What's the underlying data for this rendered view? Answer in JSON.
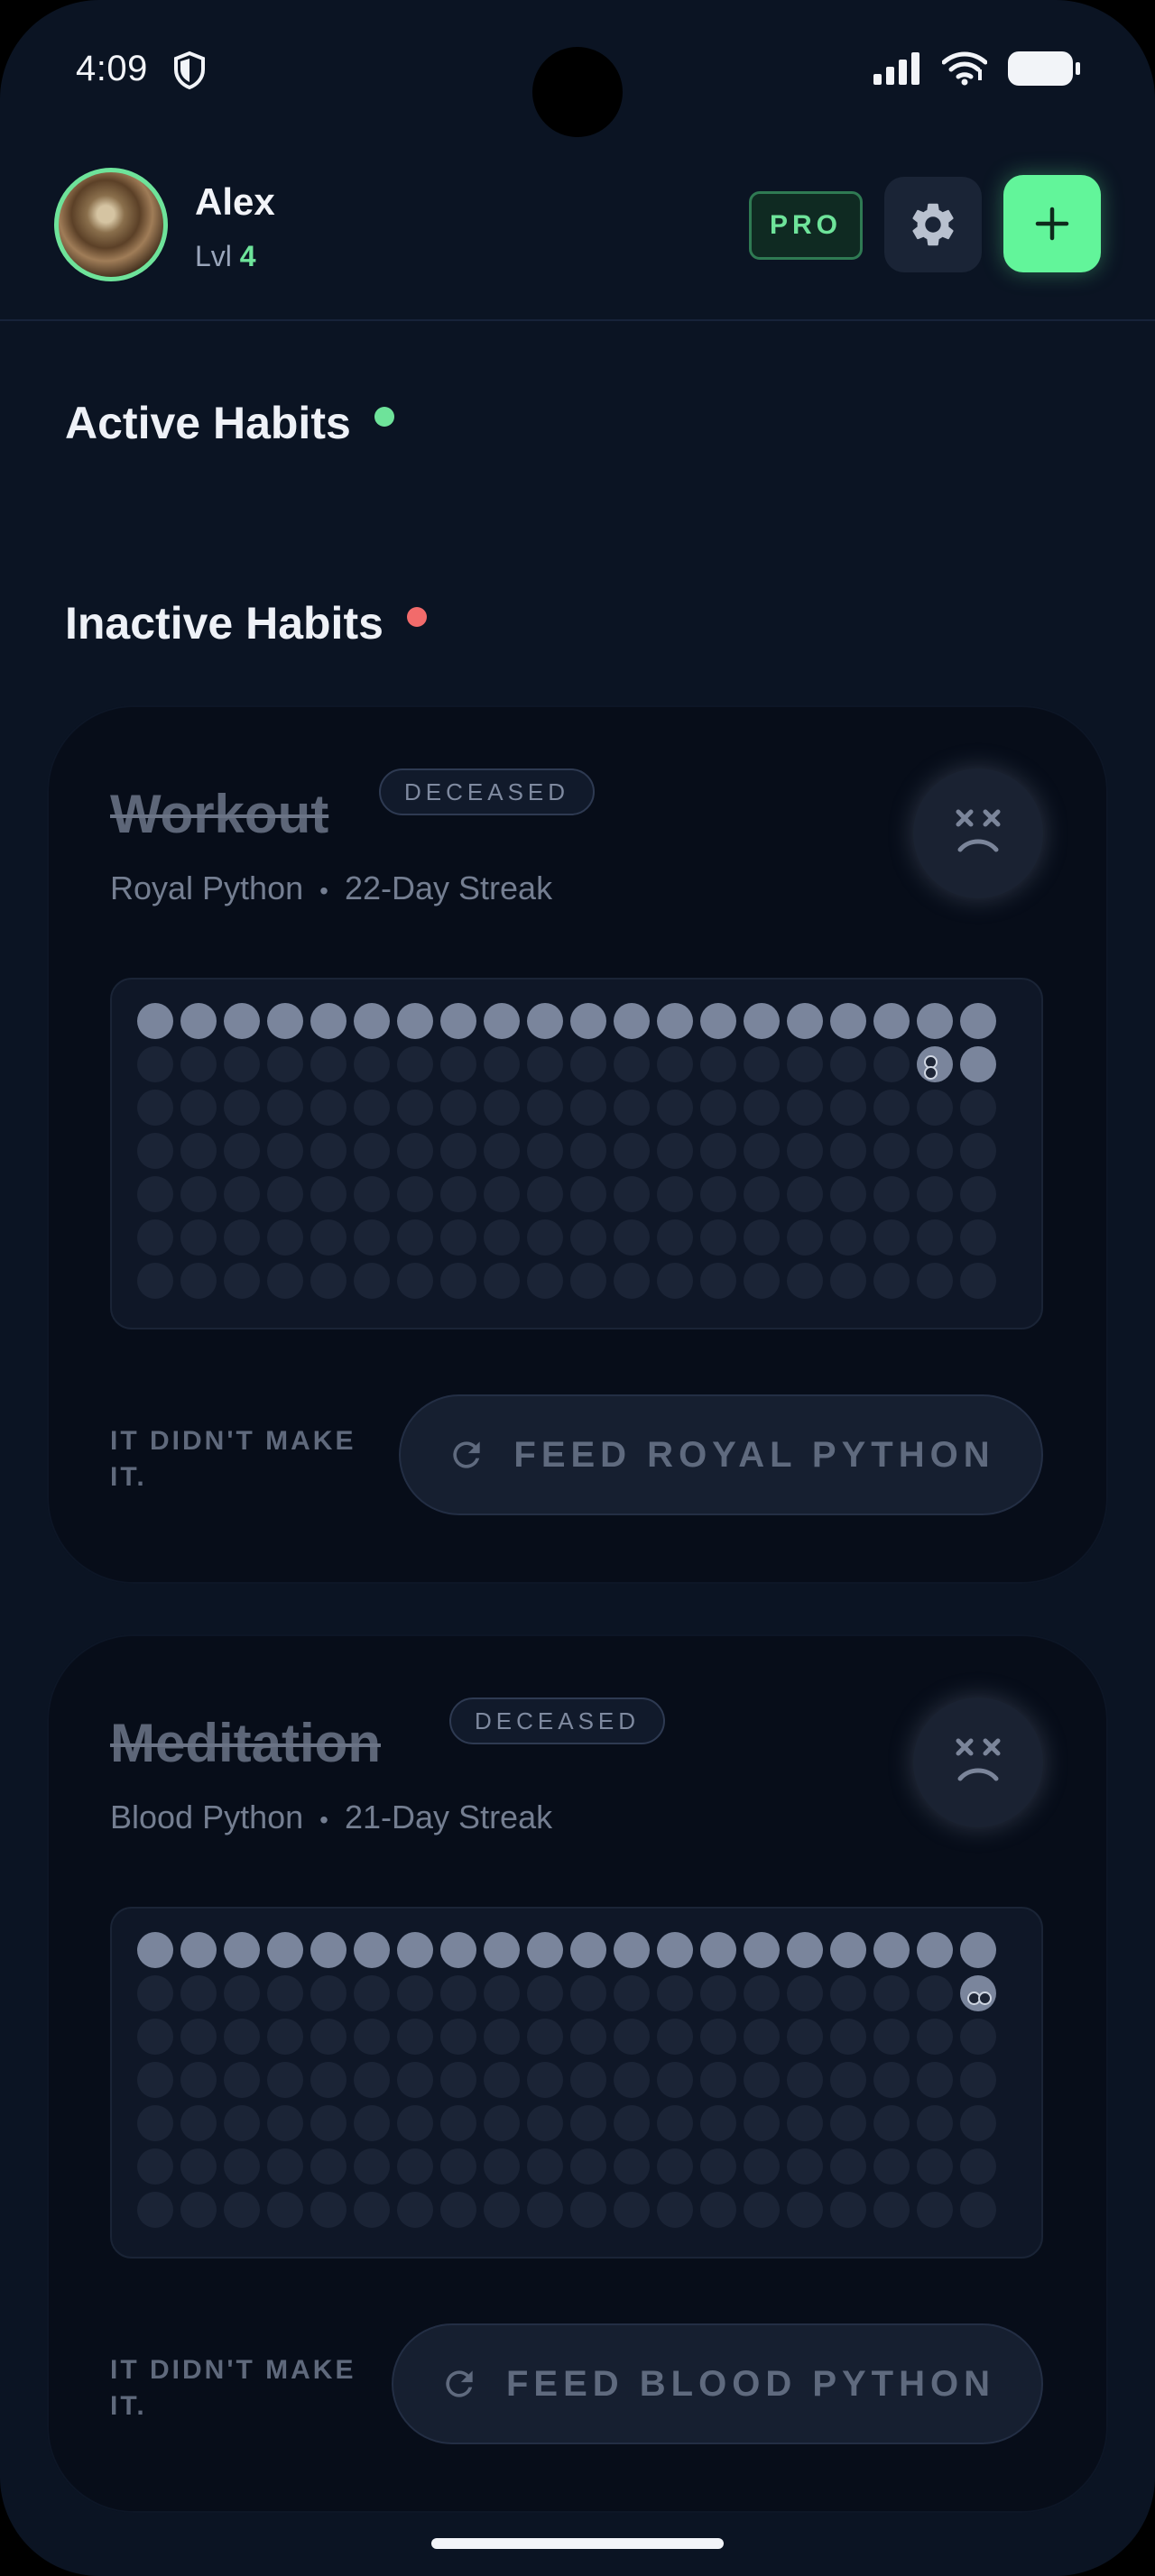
{
  "status_bar": {
    "time": "4:09"
  },
  "header": {
    "user_name": "Alex",
    "level_label": "Lvl",
    "level_value": "4",
    "pro_label": "PRO"
  },
  "sections": {
    "active_title": "Active Habits",
    "inactive_title": "Inactive Habits"
  },
  "inactive_habits": [
    {
      "name": "Workout",
      "status": "DECEASED",
      "species": "Royal Python",
      "separator": "•",
      "streak": "22-Day Streak",
      "filled_days": 22,
      "message_line1": "IT DIDN'T MAKE",
      "message_line2": "IT.",
      "feed_label": "FEED ROYAL PYTHON"
    },
    {
      "name": "Meditation",
      "status": "DECEASED",
      "species": "Blood Python",
      "separator": "•",
      "streak": "21-Day Streak",
      "filled_days": 21,
      "message_line1": "IT DIDN'T MAKE",
      "message_line2": "IT.",
      "feed_label": "FEED BLOOD PYTHON"
    }
  ],
  "colors": {
    "accent_green": "#62f59a",
    "status_red": "#f26b6b",
    "background": "#0b1423"
  }
}
